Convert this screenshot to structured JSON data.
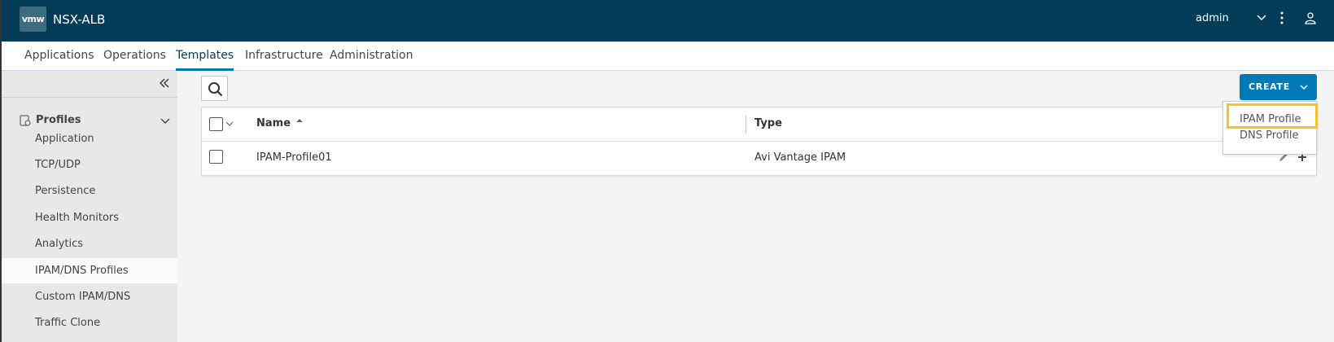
{
  "header": {
    "logo_text": "vmw",
    "app_name": "NSX-ALB",
    "user": "admin"
  },
  "nav": {
    "tabs": [
      {
        "label": "Applications"
      },
      {
        "label": "Operations"
      },
      {
        "label": "Templates",
        "active": true
      },
      {
        "label": "Infrastructure"
      },
      {
        "label": "Administration"
      }
    ]
  },
  "sidebar": {
    "section": "Profiles",
    "items": [
      {
        "label": "Application"
      },
      {
        "label": "TCP/UDP"
      },
      {
        "label": "Persistence"
      },
      {
        "label": "Health Monitors"
      },
      {
        "label": "Analytics"
      },
      {
        "label": "IPAM/DNS Profiles",
        "active": true
      },
      {
        "label": "Custom IPAM/DNS"
      },
      {
        "label": "Traffic Clone"
      }
    ]
  },
  "toolbar": {
    "create_label": "CREATE"
  },
  "create_menu": {
    "items": [
      {
        "label": "IPAM Profile",
        "highlighted": true
      },
      {
        "label": "DNS Profile"
      }
    ]
  },
  "table": {
    "columns": [
      {
        "label": "Name",
        "sort": "ascending"
      },
      {
        "label": "Type"
      }
    ],
    "rows": [
      {
        "name": "IPAM-Profile01",
        "type": "Avi Vantage IPAM"
      }
    ]
  },
  "colors": {
    "header_bg": "#033c57",
    "accent": "#0079b8",
    "highlight": "#f1c232"
  }
}
